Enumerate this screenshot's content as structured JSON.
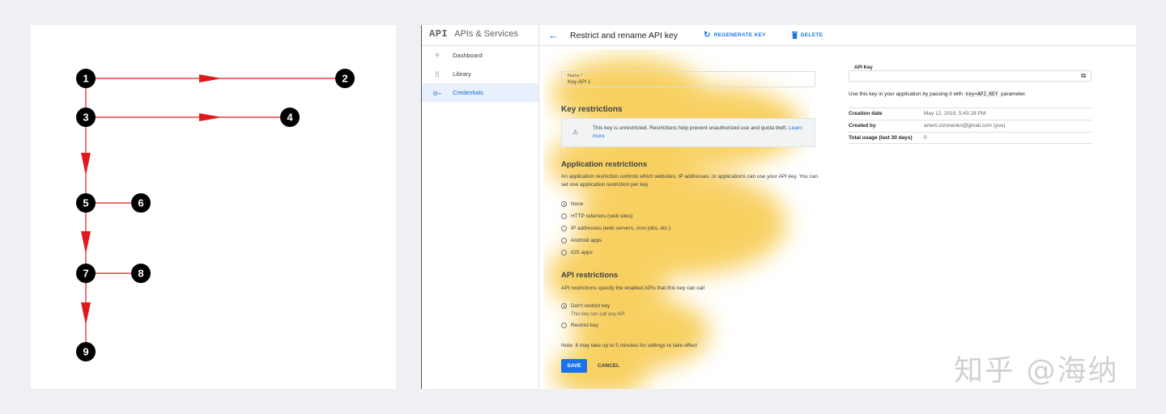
{
  "diagram": {
    "nodes": [
      "1",
      "2",
      "3",
      "4",
      "5",
      "6",
      "7",
      "8",
      "9"
    ],
    "colors": {
      "node": "#000000",
      "edge": "#e0191c"
    }
  },
  "console": {
    "brand": {
      "logo": "API",
      "title": "APIs & Services"
    },
    "header": {
      "title": "Restrict and rename API key",
      "regenerate_label": "REGENERATE KEY",
      "delete_label": "DELETE"
    },
    "sidebar": {
      "items": [
        {
          "label": "Dashboard",
          "icon": "dashboard-icon"
        },
        {
          "label": "Library",
          "icon": "library-icon"
        },
        {
          "label": "Credentials",
          "icon": "key-icon"
        }
      ]
    },
    "form": {
      "name_label": "Name *",
      "name_value": "Key API 1",
      "key_restrictions_title": "Key restrictions",
      "warning_text": "This key is unrestricted. Restrictions help prevent unauthorized use and quota theft.",
      "warning_link": "Learn more",
      "app_restrictions_title": "Application restrictions",
      "app_restrictions_desc": "An application restriction controls which websites, IP addresses, or applications can use your API key. You can set one application restriction per key.",
      "app_options": [
        "None",
        "HTTP referrers (web sites)",
        "IP addresses (web servers, cron jobs, etc.)",
        "Android apps",
        "iOS apps"
      ],
      "api_restrictions_title": "API restrictions",
      "api_restrictions_desc": "API restrictions specify the enabled APIs that this key can call",
      "api_options": [
        "Don't restrict key",
        "Restrict key"
      ],
      "api_option_note": "This key can call any API",
      "note": "Note: It may take up to 5 minutes for settings to take effect",
      "save_label": "SAVE",
      "cancel_label": "CANCEL"
    },
    "info": {
      "api_key_label": "API Key",
      "use_text_before": "Use this key in your application by passing it with",
      "use_code": "key=API_KEY",
      "use_text_after": "parameter.",
      "rows": [
        {
          "key": "Creation date",
          "value": "May 12, 2019, 5:43:28 PM"
        },
        {
          "key": "Created by",
          "value": "artem.sizonenko@gmail.com (you)"
        },
        {
          "key": "Total usage (last 30 days)",
          "value": "0"
        }
      ]
    },
    "accent_color": "#1a73e8",
    "heatmap_color": "#f6c12e"
  },
  "watermark": "知乎 @海纳"
}
